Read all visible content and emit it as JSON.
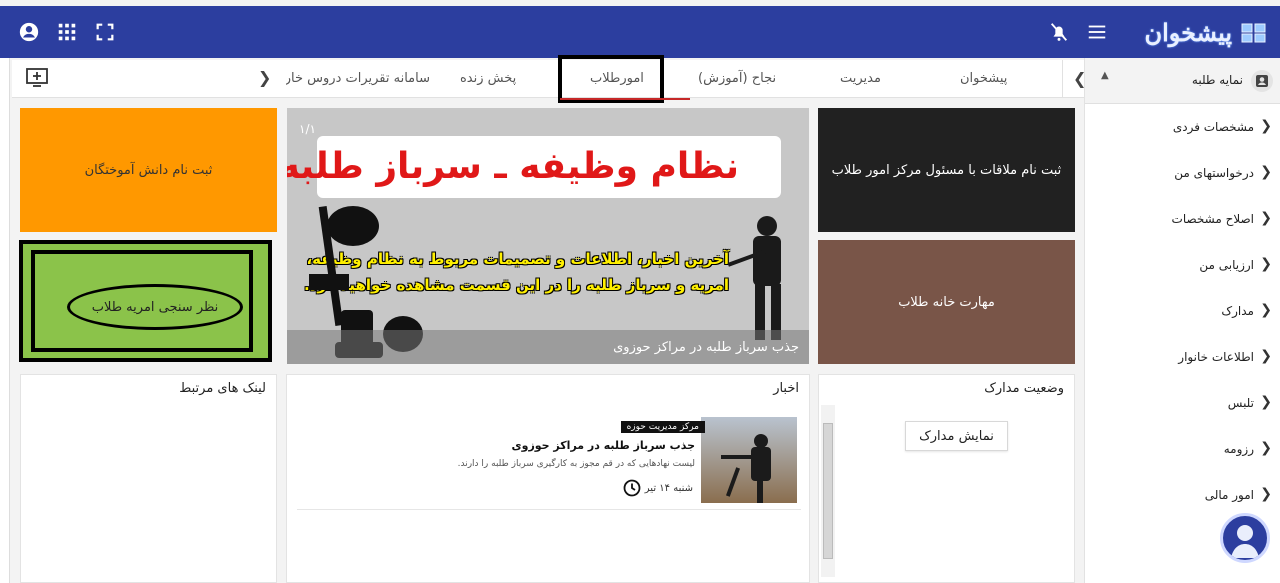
{
  "header": {
    "logo_text": "پیشخوان",
    "icons": [
      "account-circle-icon",
      "apps-grid-icon",
      "fullscreen-icon",
      "notifications-off-icon",
      "menu-icon"
    ]
  },
  "tabs": {
    "items": [
      {
        "label": "پیشخوان"
      },
      {
        "label": "مدیریت"
      },
      {
        "label": "نجاح (آموزش)"
      },
      {
        "label": "امورطلاب"
      },
      {
        "label": "پخش زنده"
      },
      {
        "label": "سامانه تقریرات دروس خارج"
      }
    ],
    "active_index": 3
  },
  "sidebar": {
    "header_label": "نمایه طلبه",
    "items": [
      {
        "label": "مشخصات فردی"
      },
      {
        "label": "درخواستهای من"
      },
      {
        "label": "اصلاح مشخصات"
      },
      {
        "label": "ارزیابی من"
      },
      {
        "label": "مدارک"
      },
      {
        "label": "اطلاعات خانوار"
      },
      {
        "label": "تلبس"
      },
      {
        "label": "رزومه"
      },
      {
        "label": "امور مالی"
      }
    ]
  },
  "tiles": {
    "orange": "ثبت نام دانش آموختگان",
    "green": "نظر سنجی امریه طلاب",
    "dark": "ثبت نام ملاقات با مسئول مرکز امور طلاب",
    "brown": "مهارت خانه طلاب"
  },
  "banner": {
    "counter": "۱/۱",
    "headline": "نظام وظیفه ـ سرباز طلبه",
    "subtitle": "آخرین اخبار، اطلاعات و تصمیمات مربوط به نظام وظیفه، امریه و سرباز طلبه را در این قسمت مشاهده خواهید کرد.",
    "caption": "جذب سرباز طلبه در مراکز حوزوی"
  },
  "panels": {
    "links_title": "لینک های مرتبط",
    "news_title": "اخبار",
    "docs_title": "وضعیت مدارک",
    "docs_button": "نمایش مدارک"
  },
  "news": {
    "tag": "مرکز مدیریت حوزه",
    "headline": "جذب سرباز طلبه در مراکز حوزوی",
    "description": "لیست نهادهایی که در قم مجوز به کارگیری سرباز طلبه را دارند.",
    "date": "شنبه ۱۴ تیر"
  },
  "colors": {
    "topbar": "#2c3e9f",
    "orange_tile": "#ff9800",
    "green_tile": "#8bc34a",
    "dark_tile": "#212121",
    "brown_tile": "#795548",
    "headline_red": "#e01818",
    "subtitle_yellow": "#fff000"
  }
}
